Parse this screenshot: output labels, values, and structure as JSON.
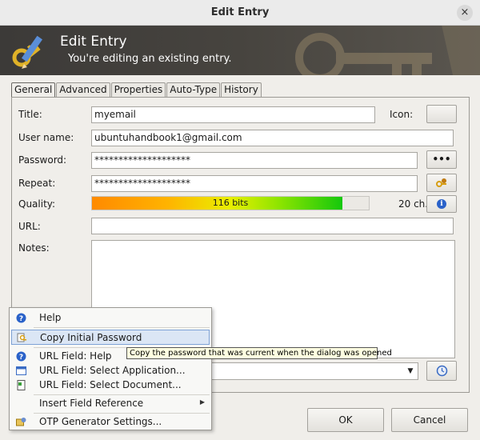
{
  "window": {
    "title": "Edit Entry",
    "close_glyph": "×"
  },
  "banner": {
    "title": "Edit Entry",
    "subtitle": "You're editing an existing entry."
  },
  "tabs": [
    {
      "label": "General",
      "active": true
    },
    {
      "label": "Advanced"
    },
    {
      "label": "Properties"
    },
    {
      "label": "Auto-Type"
    },
    {
      "label": "History"
    }
  ],
  "form": {
    "title_label": "Title:",
    "title_value": "myemail",
    "icon_label": "Icon:",
    "username_label": "User name:",
    "username_value": "ubuntuhandbook1@gmail.com",
    "password_label": "Password:",
    "password_value": "********************",
    "repeat_label": "Repeat:",
    "repeat_value": "********************",
    "reveal_button": "•••",
    "quality_label": "Quality:",
    "quality_text": "116 bits",
    "quality_fraction": 0.905,
    "char_count": "20 ch.",
    "url_label": "URL:",
    "url_value": "",
    "notes_label": "Notes:",
    "notes_value": ""
  },
  "menu": {
    "items": [
      {
        "label": "Help",
        "icon": "help-icon"
      },
      {
        "label": "Copy Initial Password",
        "icon": "key-copy-icon",
        "highlighted": true
      },
      {
        "label": "URL Field: Help",
        "icon": "help-icon"
      },
      {
        "label": "URL Field: Select Application...",
        "icon": "application-icon"
      },
      {
        "label": "URL Field: Select Document...",
        "icon": "document-icon"
      },
      {
        "label": "Insert Field Reference",
        "icon": "",
        "submenu": true
      },
      {
        "label": "OTP Generator Settings...",
        "icon": "otp-settings-icon"
      }
    ]
  },
  "tooltip": "Copy the password that was current when the dialog was opened",
  "footer": {
    "ok_label": "OK",
    "cancel_label": "Cancel"
  },
  "colors": {
    "banner": "#3f3d3a",
    "accent": "#2a62c9",
    "highlight": "#dbe6f5"
  }
}
